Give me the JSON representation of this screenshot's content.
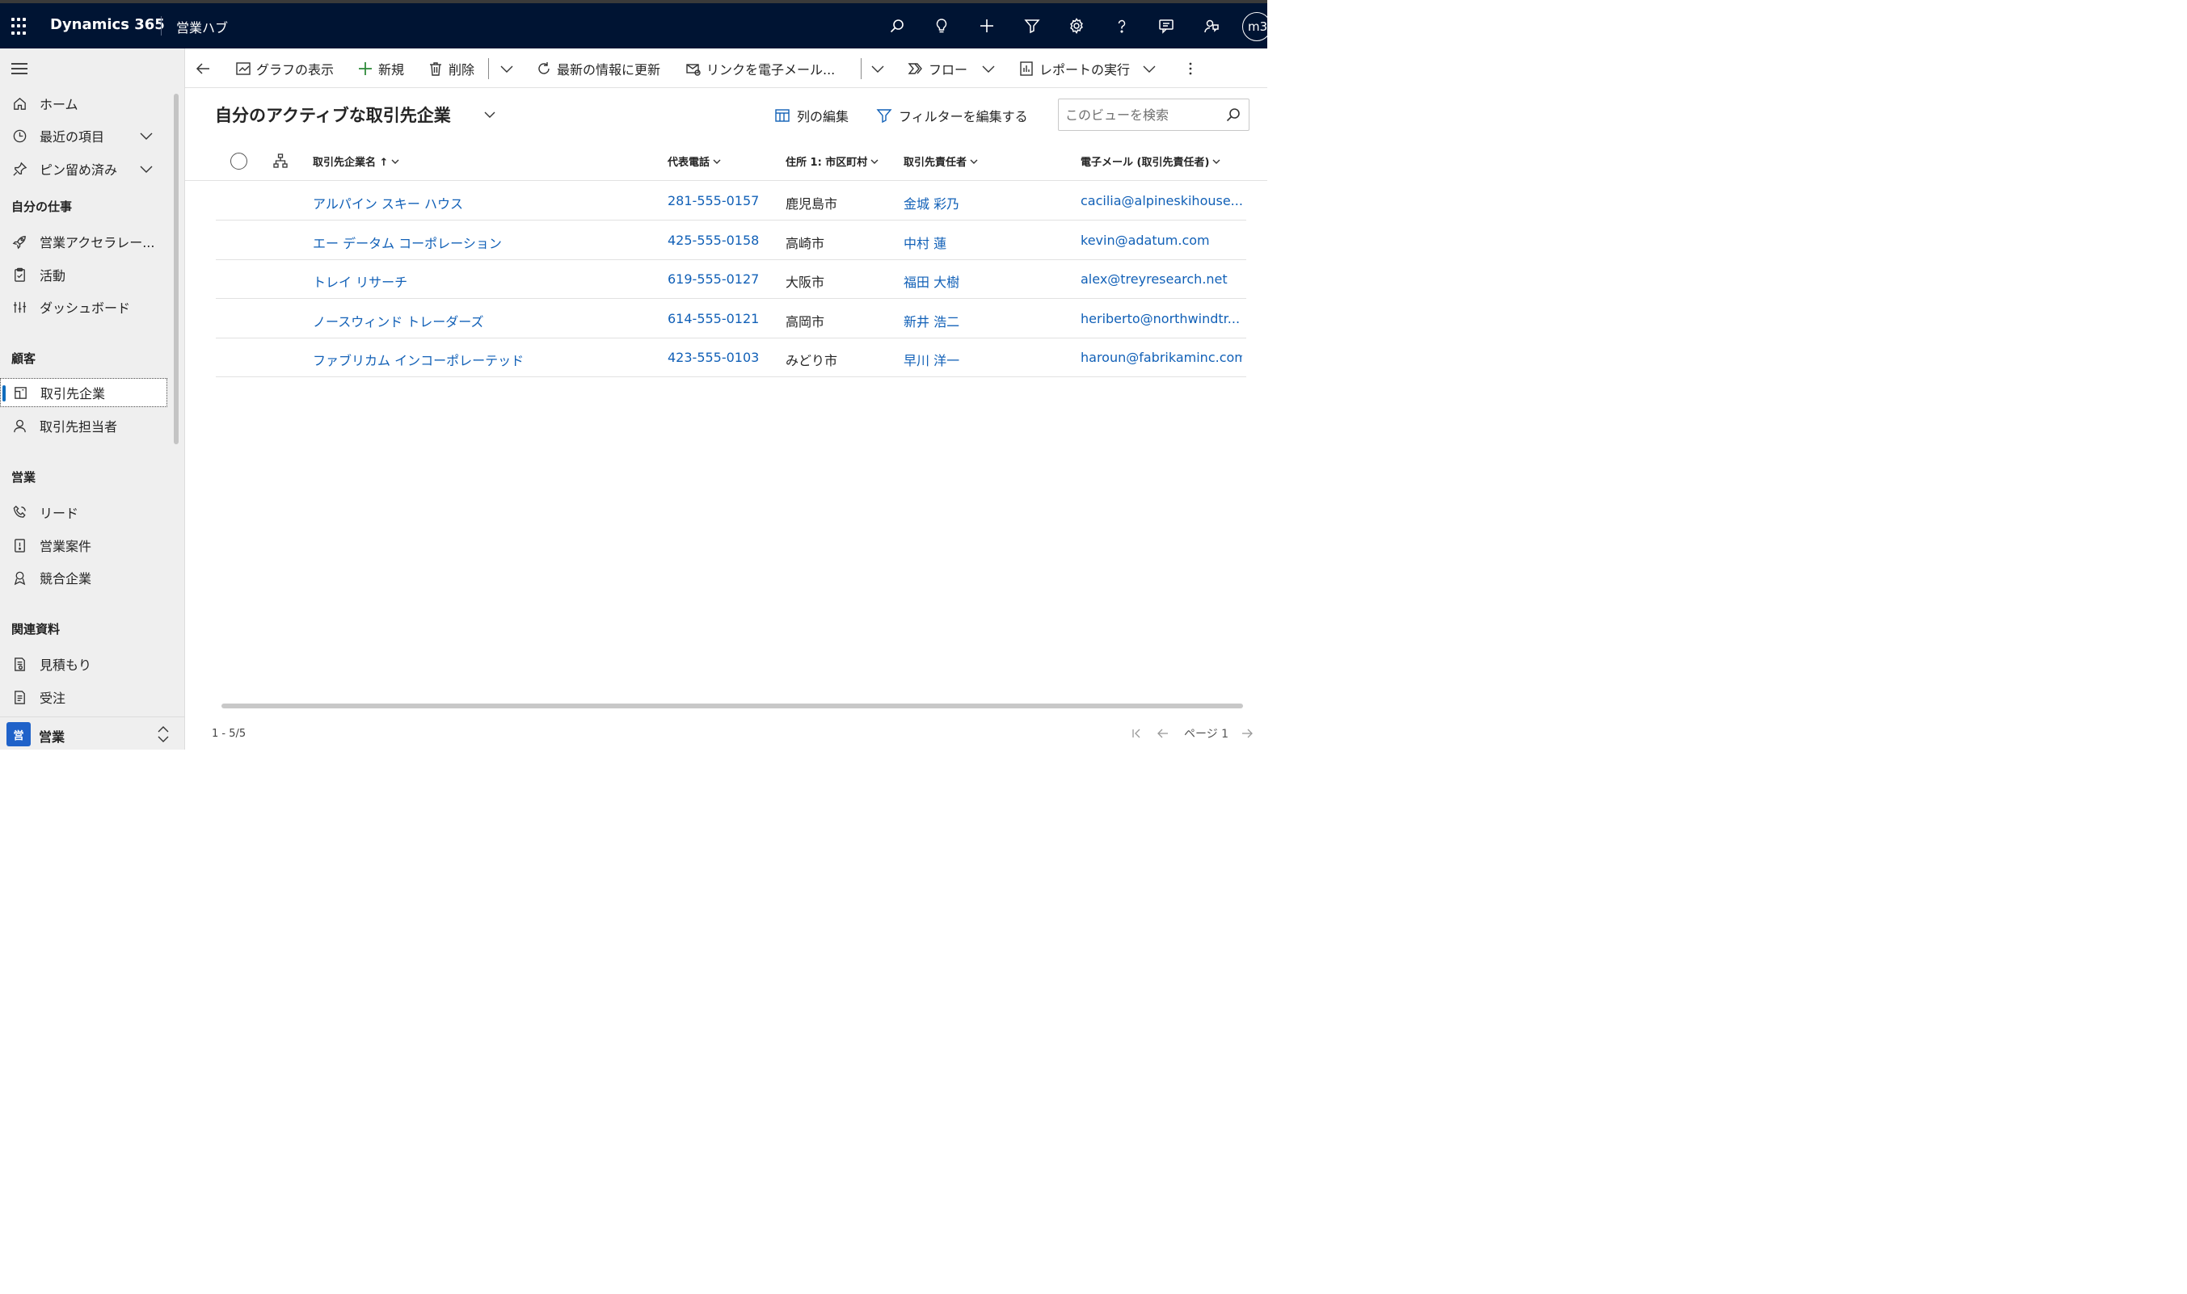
{
  "header": {
    "app_name": "Dynamics 365",
    "hub_name": "営業ハブ",
    "avatar_initials": "m3",
    "icons": [
      "search-icon",
      "lightbulb-icon",
      "plus-icon",
      "filter-icon",
      "gear-icon",
      "help-icon",
      "chat-icon",
      "feedback-icon"
    ]
  },
  "sidebar": {
    "top_items": [
      {
        "label": "ホーム",
        "icon": "home-icon"
      },
      {
        "label": "最近の項目",
        "icon": "clock-icon"
      },
      {
        "label": "ピン留め済み",
        "icon": "pin-icon"
      }
    ],
    "sections": [
      {
        "title": "自分の仕事",
        "items": [
          {
            "label": "営業アクセラレー...",
            "icon": "rocket-icon"
          },
          {
            "label": "活動",
            "icon": "clipboard-icon"
          },
          {
            "label": "ダッシュボード",
            "icon": "dashboard-icon"
          }
        ]
      },
      {
        "title": "顧客",
        "items": [
          {
            "label": "取引先企業",
            "icon": "building-icon",
            "active": true
          },
          {
            "label": "取引先担当者",
            "icon": "person-icon"
          }
        ]
      },
      {
        "title": "営業",
        "items": [
          {
            "label": "リード",
            "icon": "phone-icon"
          },
          {
            "label": "営業案件",
            "icon": "opportunity-icon"
          },
          {
            "label": "競合企業",
            "icon": "competitor-icon"
          }
        ]
      },
      {
        "title": "関連資料",
        "items": [
          {
            "label": "見積もり",
            "icon": "quote-icon"
          },
          {
            "label": "受注",
            "icon": "order-icon"
          }
        ]
      }
    ],
    "area": {
      "badge": "営",
      "label": "営業"
    }
  },
  "commands": {
    "show_chart": "グラフの表示",
    "new": "新規",
    "delete": "削除",
    "refresh": "最新の情報に更新",
    "email_link": "リンクを電子メール...",
    "flow": "フロー",
    "run_report": "レポートの実行"
  },
  "view": {
    "title": "自分のアクティブな取引先企業",
    "edit_columns": "列の編集",
    "edit_filters": "フィルターを編集する",
    "search_placeholder": "このビューを検索"
  },
  "grid": {
    "columns": [
      "取引先企業名 ↑",
      "代表電話",
      "住所 1: 市区町村",
      "取引先責任者",
      "電子メール (取引先責任者)"
    ],
    "rows": [
      {
        "name": "アルパイン スキー ハウス",
        "phone": "281-555-0157",
        "city": "鹿児島市",
        "contact": "金城 彩乃",
        "email": "cacilia@alpineskihouse...."
      },
      {
        "name": "エー データム コーポレーション",
        "phone": "425-555-0158",
        "city": "高崎市",
        "contact": "中村 蓮",
        "email": "kevin@adatum.com"
      },
      {
        "name": "トレイ リサーチ",
        "phone": "619-555-0127",
        "city": "大阪市",
        "contact": "福田 大樹",
        "email": "alex@treyresearch.net"
      },
      {
        "name": "ノースウィンド トレーダーズ",
        "phone": "614-555-0121",
        "city": "高岡市",
        "contact": "新井 浩二",
        "email": "heriberto@northwindtr..."
      },
      {
        "name": "ファブリカム インコーポレーテッド",
        "phone": "423-555-0103",
        "city": "みどり市",
        "contact": "早川 洋一",
        "email": "haroun@fabrikaminc.com"
      }
    ]
  },
  "footer": {
    "count": "1 - 5/5",
    "page": "ページ 1"
  }
}
